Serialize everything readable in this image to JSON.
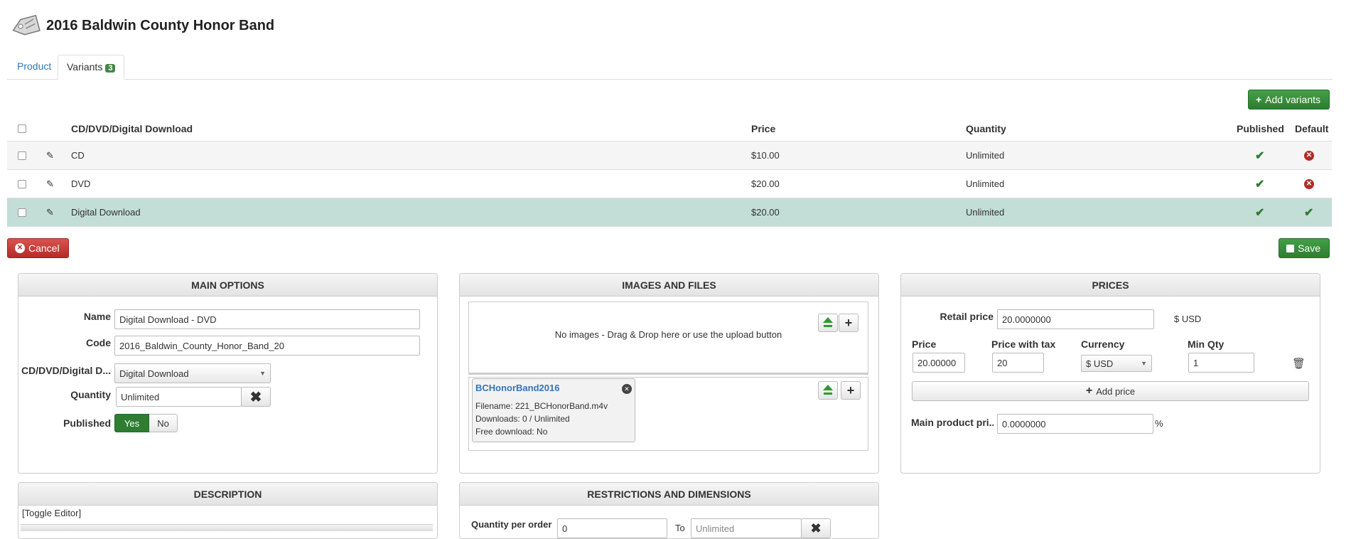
{
  "header": {
    "title": "2016 Baldwin County Honor Band"
  },
  "tabs": [
    {
      "label": "Product"
    },
    {
      "label": "Variants",
      "badge": "3"
    }
  ],
  "toolbar": {
    "add_variants": "Add variants",
    "cancel": "Cancel",
    "save": "Save"
  },
  "table": {
    "columns": {
      "name": "CD/DVD/Digital Download",
      "price": "Price",
      "quantity": "Quantity",
      "published": "Published",
      "default": "Default"
    },
    "rows": [
      {
        "name": "CD",
        "price": "$10.00",
        "quantity": "Unlimited",
        "published": true,
        "default": false
      },
      {
        "name": "DVD",
        "price": "$20.00",
        "quantity": "Unlimited",
        "published": true,
        "default": false
      },
      {
        "name": "Digital Download",
        "price": "$20.00",
        "quantity": "Unlimited",
        "published": true,
        "default": true
      }
    ]
  },
  "main_options": {
    "title": "MAIN OPTIONS",
    "name_label": "Name",
    "name_value": "Digital Download - DVD",
    "code_label": "Code",
    "code_value": "2016_Baldwin_County_Honor_Band_20",
    "variant_label": "CD/DVD/Digital D...",
    "variant_value": "Digital Download",
    "quantity_label": "Quantity",
    "quantity_value": "Unlimited",
    "published_label": "Published",
    "yes": "Yes",
    "no": "No"
  },
  "images": {
    "title": "IMAGES AND FILES",
    "empty_text": "No images - Drag & Drop here or use the upload button",
    "file": {
      "name": "BCHonorBand2016",
      "filename": "Filename: 221_BCHonorBand.m4v",
      "downloads": "Downloads: 0 / Unlimited",
      "free": "Free download: No"
    }
  },
  "prices": {
    "title": "PRICES",
    "retail_label": "Retail price",
    "retail_value": "20.0000000",
    "retail_currency": "$ USD",
    "price_label": "Price",
    "price_value": "20.00000",
    "tax_label": "Price with tax",
    "tax_value": "20",
    "currency_label": "Currency",
    "currency_value": "$ USD",
    "minqty_label": "Min Qty",
    "minqty_value": "1",
    "add_price": "Add price",
    "main_price_label": "Main product pri...",
    "main_price_value": "0.0000000",
    "percent": "%"
  },
  "description": {
    "title": "DESCRIPTION",
    "toggle": "[Toggle Editor]"
  },
  "restrictions": {
    "title": "RESTRICTIONS AND DIMENSIONS",
    "qty_label": "Quantity per order",
    "qty_from": "0",
    "to_label": "To",
    "qty_to": "Unlimited"
  }
}
